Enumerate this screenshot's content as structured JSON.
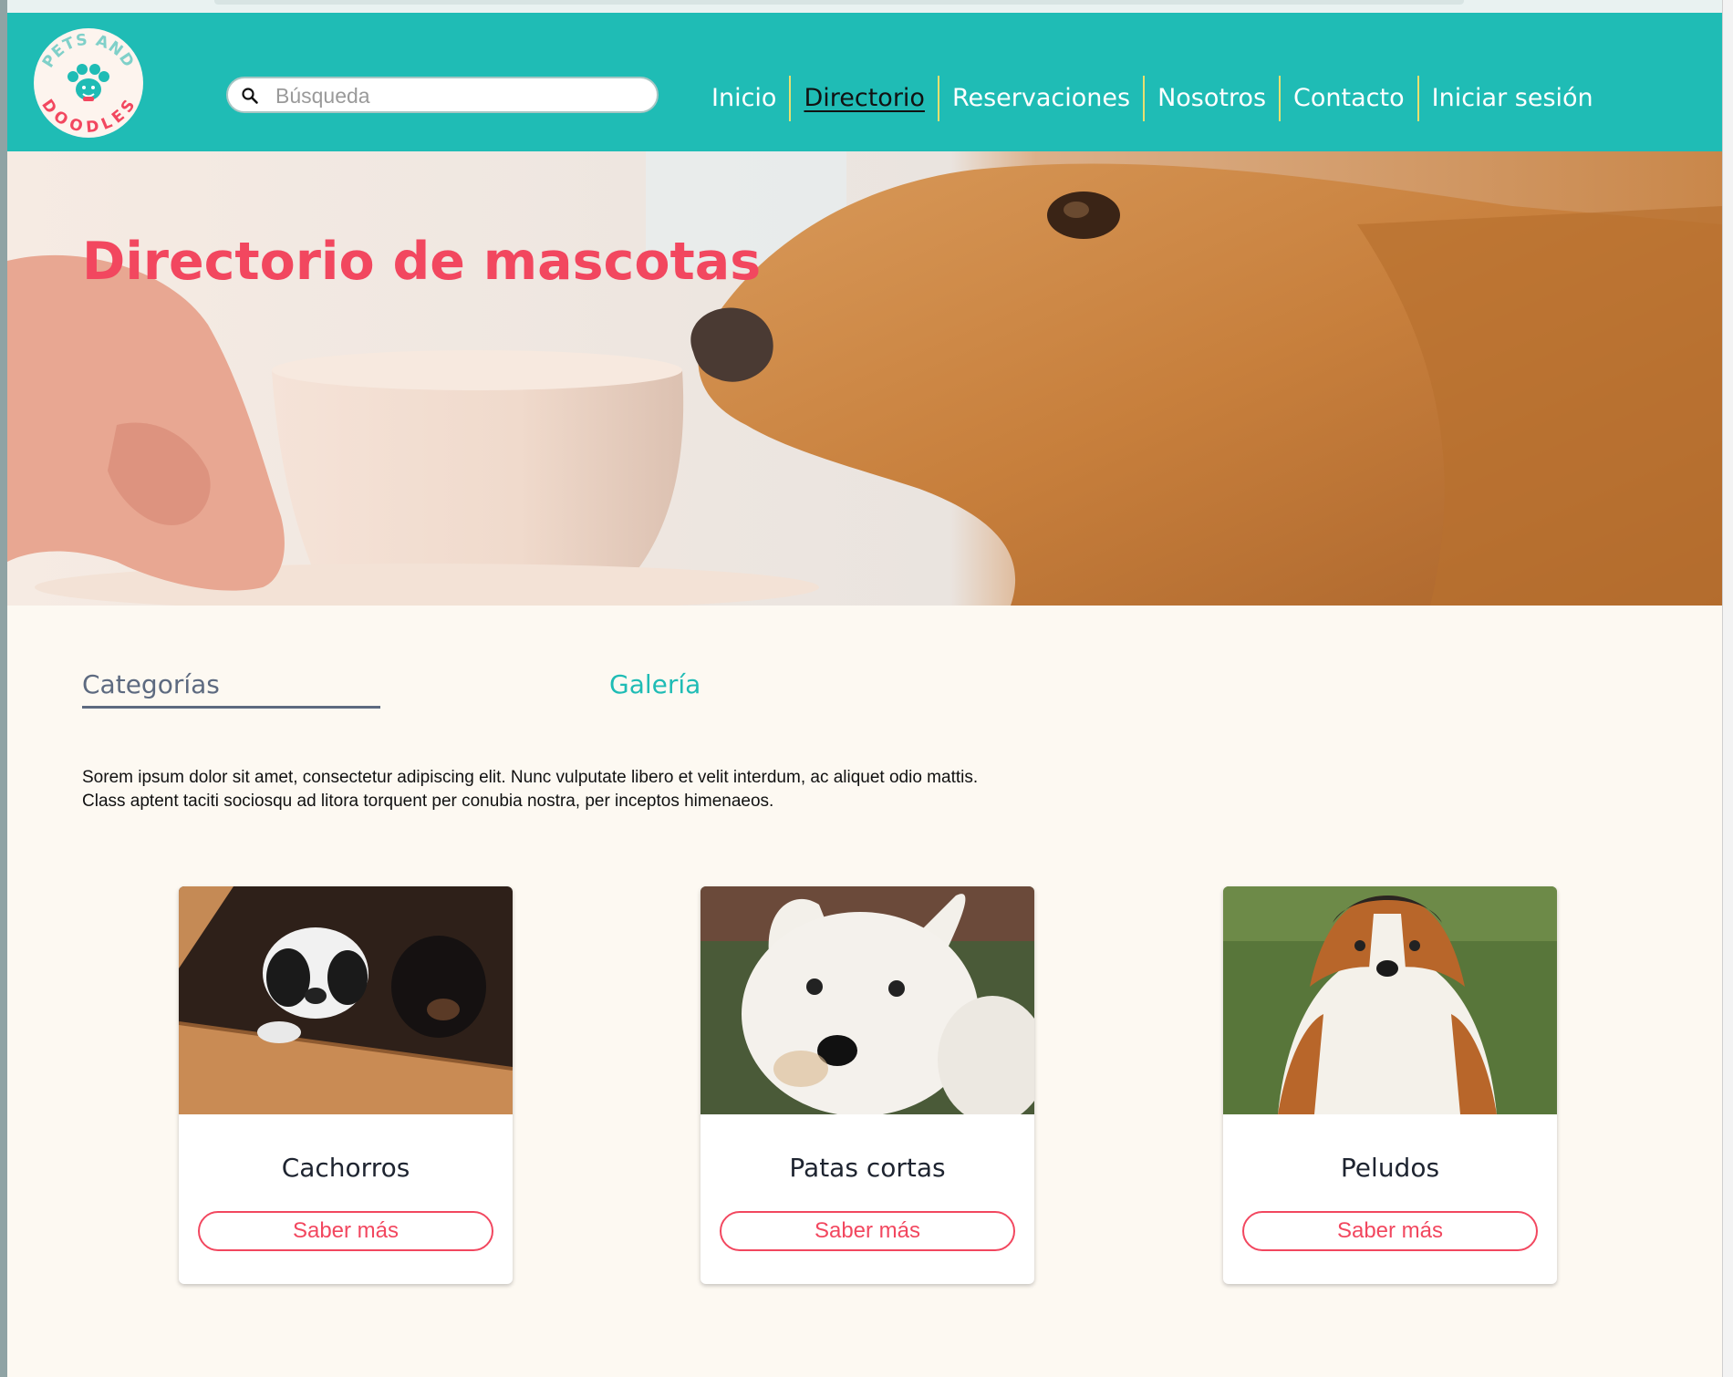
{
  "brand": {
    "logo_text_top": "PETS AND",
    "logo_text_bottom": "DOODLES"
  },
  "search": {
    "placeholder": "Búsqueda"
  },
  "nav": {
    "items": [
      {
        "label": "Inicio"
      },
      {
        "label": "Directorio"
      },
      {
        "label": "Reservaciones"
      },
      {
        "label": "Nosotros"
      },
      {
        "label": "Contacto"
      },
      {
        "label": "Iniciar sesión"
      }
    ],
    "active": "Directorio"
  },
  "hero": {
    "title": "Directorio de mascotas"
  },
  "tabs": {
    "categorias": "Categorías",
    "galeria": "Galería"
  },
  "description": {
    "line1": "Sorem ipsum dolor sit amet, consectetur adipiscing elit. Nunc vulputate libero et velit interdum, ac aliquet odio mattis.",
    "line2": "Class aptent taciti sociosqu ad litora torquent per conubia nostra, per inceptos himenaeos."
  },
  "cards": [
    {
      "title": "Cachorros",
      "button": "Saber más"
    },
    {
      "title": "Patas cortas",
      "button": "Saber más"
    },
    {
      "title": "Peludos",
      "button": "Saber más"
    }
  ],
  "colors": {
    "header": "#1fbcb5",
    "accent": "#f2475f",
    "nav_separator": "#e9df6f",
    "background": "#fdf9f2",
    "tab_inactive": "#5d6a80"
  },
  "icons": {
    "search": "search-icon"
  }
}
